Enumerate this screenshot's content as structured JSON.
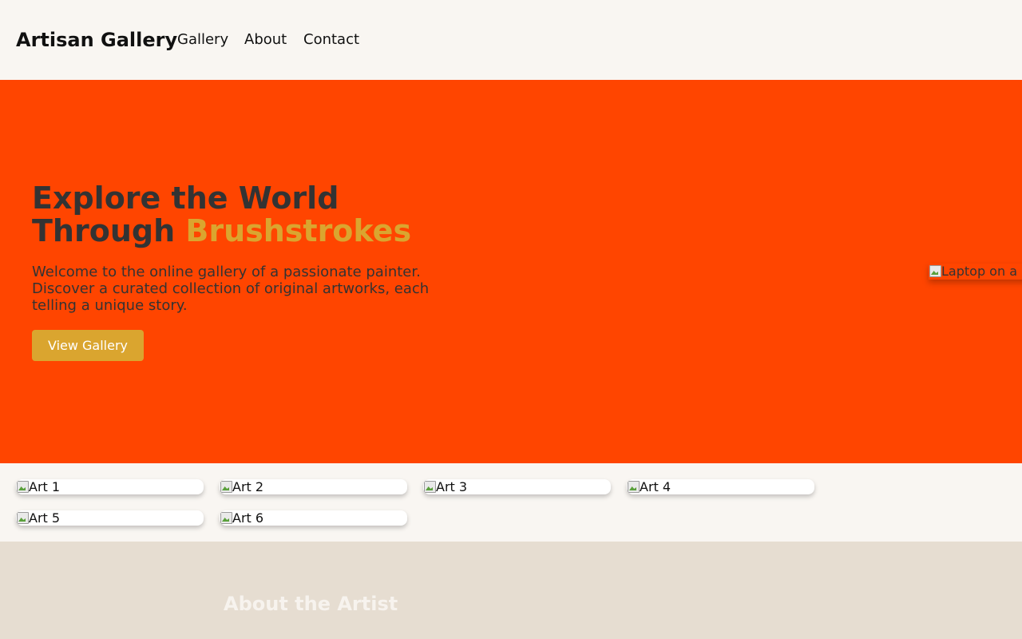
{
  "header": {
    "logo": "Artisan Gallery",
    "nav": [
      "Gallery",
      "About",
      "Contact"
    ]
  },
  "hero": {
    "title_part1": "Explore the World",
    "title_part2": "Through ",
    "title_accent": "Brushstrokes",
    "text": "Welcome to the online gallery of a passionate painter. Discover a curated collection of original artworks, each telling a unique story.",
    "button": "View Gallery",
    "image_alt": "Laptop on a"
  },
  "gallery": {
    "items": [
      "Art 1",
      "Art 2",
      "Art 3",
      "Art 4",
      "Art 5",
      "Art 6"
    ]
  },
  "about": {
    "title": "About the Artist"
  },
  "colors": {
    "hero_bg": "#ff4500",
    "accent": "#daa52f",
    "about_bg": "#e6ddd1",
    "page_bg": "#f9f6f2"
  },
  "icons": {
    "image_placeholder": "broken-image-icon"
  }
}
